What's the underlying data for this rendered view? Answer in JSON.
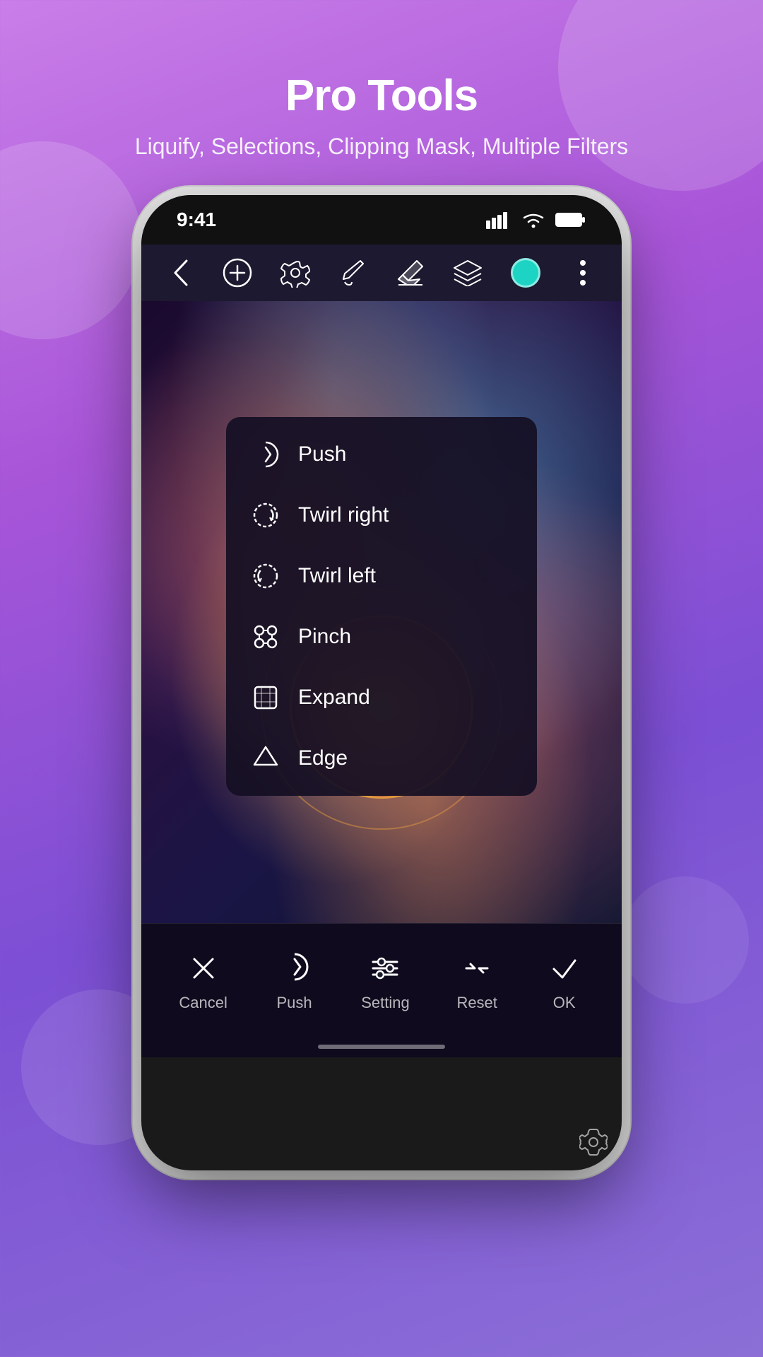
{
  "header": {
    "title": "Pro Tools",
    "subtitle": "Liquify, Selections, Clipping Mask, Multiple Filters"
  },
  "phone": {
    "statusBar": {
      "time": "9:41"
    },
    "toolbar": {
      "backLabel": "back",
      "addLabel": "add",
      "settingsLabel": "settings",
      "brushLabel": "brush",
      "eraserLabel": "eraser",
      "layersLabel": "layers",
      "colorLabel": "color",
      "moreLabel": "more"
    },
    "dropdownMenu": {
      "items": [
        {
          "id": "push",
          "label": "Push"
        },
        {
          "id": "twirl-right",
          "label": "Twirl right"
        },
        {
          "id": "twirl-left",
          "label": "Twirl left"
        },
        {
          "id": "pinch",
          "label": "Pinch"
        },
        {
          "id": "expand",
          "label": "Expand"
        },
        {
          "id": "edge",
          "label": "Edge"
        }
      ]
    },
    "bottomBar": {
      "cancel": "Cancel",
      "push": "Push",
      "setting": "Setting",
      "reset": "Reset",
      "ok": "OK"
    }
  }
}
